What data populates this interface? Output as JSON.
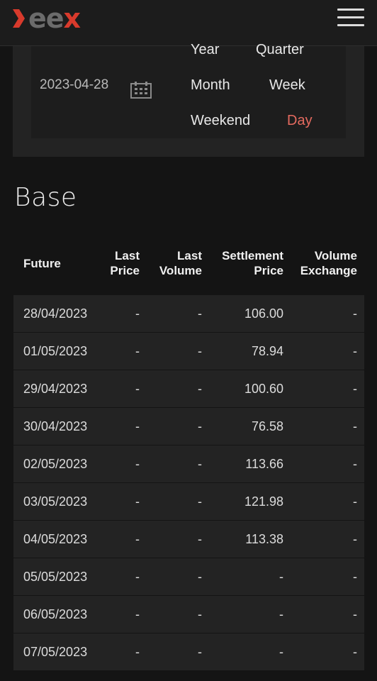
{
  "header": {
    "logo": {
      "ee": "ee",
      "x": "x"
    },
    "menu_icon": "hamburger-menu-icon"
  },
  "filter": {
    "date": "2023-04-28",
    "calendar_icon": "calendar-icon",
    "periods": {
      "year": "Year",
      "quarter": "Quarter",
      "month": "Month",
      "week": "Week",
      "weekend": "Weekend",
      "day": "Day"
    },
    "active_period": "Day",
    "active_color": "#e46a5f"
  },
  "section": {
    "title": "Base"
  },
  "table": {
    "headers": {
      "future": "Future",
      "last_price_1": "Last",
      "last_price_2": "Price",
      "last_volume_1": "Last",
      "last_volume_2": "Volume",
      "settlement_1": "Settlement",
      "settlement_2": "Price",
      "volume_exchange_1": "Volume",
      "volume_exchange_2": "Exchange"
    },
    "rows": [
      {
        "future": "28/04/2023",
        "last_price": "-",
        "last_volume": "-",
        "settlement": "106.00",
        "volume_exchange": "-"
      },
      {
        "future": "01/05/2023",
        "last_price": "-",
        "last_volume": "-",
        "settlement": "78.94",
        "volume_exchange": "-"
      },
      {
        "future": "29/04/2023",
        "last_price": "-",
        "last_volume": "-",
        "settlement": "100.60",
        "volume_exchange": "-"
      },
      {
        "future": "30/04/2023",
        "last_price": "-",
        "last_volume": "-",
        "settlement": "76.58",
        "volume_exchange": "-"
      },
      {
        "future": "02/05/2023",
        "last_price": "-",
        "last_volume": "-",
        "settlement": "113.66",
        "volume_exchange": "-"
      },
      {
        "future": "03/05/2023",
        "last_price": "-",
        "last_volume": "-",
        "settlement": "121.98",
        "volume_exchange": "-"
      },
      {
        "future": "04/05/2023",
        "last_price": "-",
        "last_volume": "-",
        "settlement": "113.38",
        "volume_exchange": "-"
      },
      {
        "future": "05/05/2023",
        "last_price": "-",
        "last_volume": "-",
        "settlement": "-",
        "volume_exchange": "-"
      },
      {
        "future": "06/05/2023",
        "last_price": "-",
        "last_volume": "-",
        "settlement": "-",
        "volume_exchange": "-"
      },
      {
        "future": "07/05/2023",
        "last_price": "-",
        "last_volume": "-",
        "settlement": "-",
        "volume_exchange": "-"
      }
    ]
  },
  "colors": {
    "background": "#141414",
    "panel": "#232323",
    "brand_red": "#d83a2c",
    "brand_grey": "#6b6b6b"
  }
}
